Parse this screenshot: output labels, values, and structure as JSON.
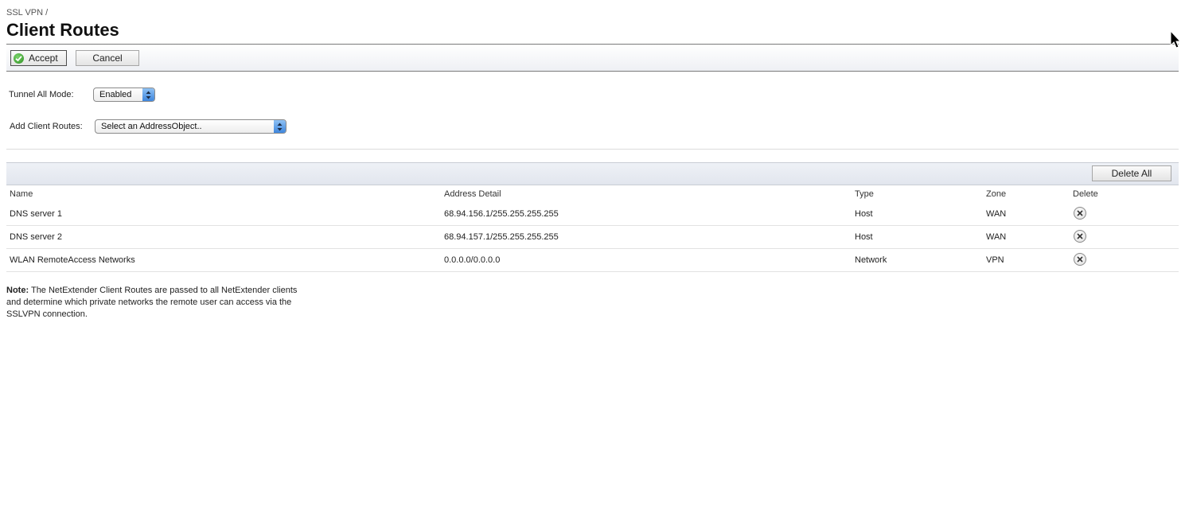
{
  "breadcrumb": "SSL VPN /",
  "title": "Client Routes",
  "toolbar": {
    "accept_label": "Accept",
    "cancel_label": "Cancel"
  },
  "form": {
    "tunnel_label": "Tunnel All Mode:",
    "tunnel_value": "Enabled",
    "routes_label": "Add Client Routes:",
    "routes_value": "Select an AddressObject.."
  },
  "table": {
    "delete_all_label": "Delete All",
    "columns": [
      "Name",
      "Address Detail",
      "Type",
      "Zone",
      "Delete"
    ],
    "rows": [
      {
        "name": "DNS server 1",
        "address": "68.94.156.1/255.255.255.255",
        "type": "Host",
        "zone": "WAN"
      },
      {
        "name": "DNS server 2",
        "address": "68.94.157.1/255.255.255.255",
        "type": "Host",
        "zone": "WAN"
      },
      {
        "name": "WLAN RemoteAccess Networks",
        "address": "0.0.0.0/0.0.0.0",
        "type": "Network",
        "zone": "VPN"
      }
    ]
  },
  "note": {
    "label": "Note:",
    "text": "The NetExtender Client Routes are passed to all NetExtender clients and determine which private networks the remote user can access via the SSLVPN connection."
  },
  "icons": {
    "accept": "check-circle-icon",
    "delete": "close-circle-icon",
    "select": "updown-arrows-icon",
    "cursor": "mouse-pointer-icon"
  },
  "colors": {
    "accept_icon": "#2d8f22",
    "select_arrows": "#3f86dd"
  }
}
